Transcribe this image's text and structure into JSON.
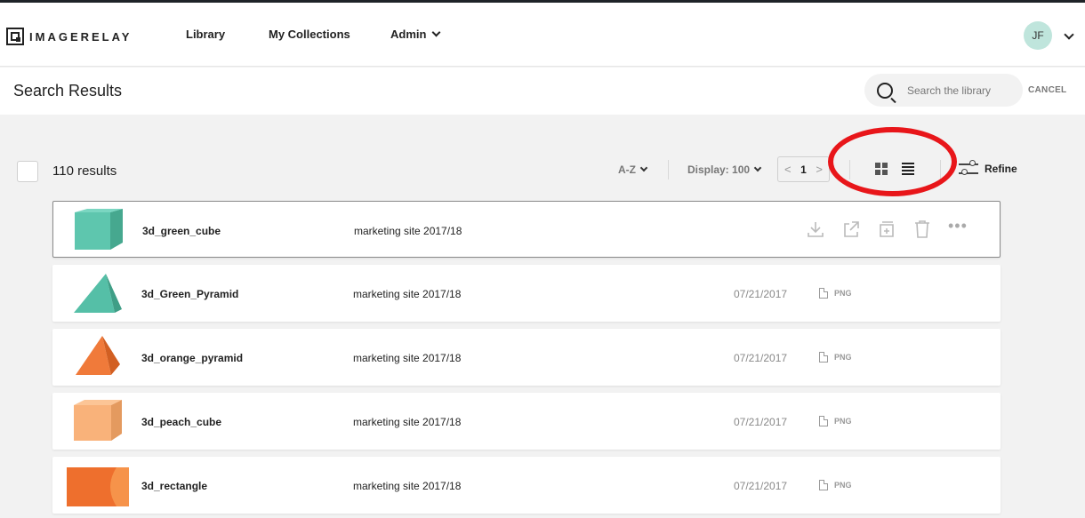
{
  "app": {
    "logo_text": "IMAGERELAY",
    "nav": {
      "library": "Library",
      "collections": "My Collections",
      "admin": "Admin"
    },
    "user_initials": "JF",
    "accent_color": "#bfe5dc"
  },
  "header": {
    "title": "Search Results",
    "search_placeholder": "Search the library",
    "cancel_label": "CANCEL"
  },
  "toolbar": {
    "results": "110 results",
    "sort_label": "A-Z",
    "display_label": "Display: 100",
    "pager_prev": "<",
    "page": "1",
    "pager_next": ">",
    "view_modes": [
      "grid-icon",
      "list-icon"
    ],
    "active_view": "list",
    "refine_label": "Refine",
    "highlight_color": "#e8161a"
  },
  "assets": [
    {
      "name": "3d_green_cube",
      "collection": "marketing site 2017/18",
      "date": "",
      "type": "",
      "thumb": "green-cube",
      "hovered": true,
      "actions": [
        "download-icon",
        "share-icon",
        "add-to-collection-icon",
        "trash-icon",
        "more-icon"
      ]
    },
    {
      "name": "3d_Green_Pyramid",
      "collection": "marketing site 2017/18",
      "date": "07/21/2017",
      "type": "PNG",
      "thumb": "green-pyramid"
    },
    {
      "name": "3d_orange_pyramid",
      "collection": "marketing site 2017/18",
      "date": "07/21/2017",
      "type": "PNG",
      "thumb": "orange-pyramid"
    },
    {
      "name": "3d_peach_cube",
      "collection": "marketing site 2017/18",
      "date": "07/21/2017",
      "type": "PNG",
      "thumb": "peach-cube"
    },
    {
      "name": "3d_rectangle",
      "collection": "marketing site 2017/18",
      "date": "07/21/2017",
      "type": "PNG",
      "thumb": "orange-rectangle"
    }
  ],
  "more_dots": "•••"
}
